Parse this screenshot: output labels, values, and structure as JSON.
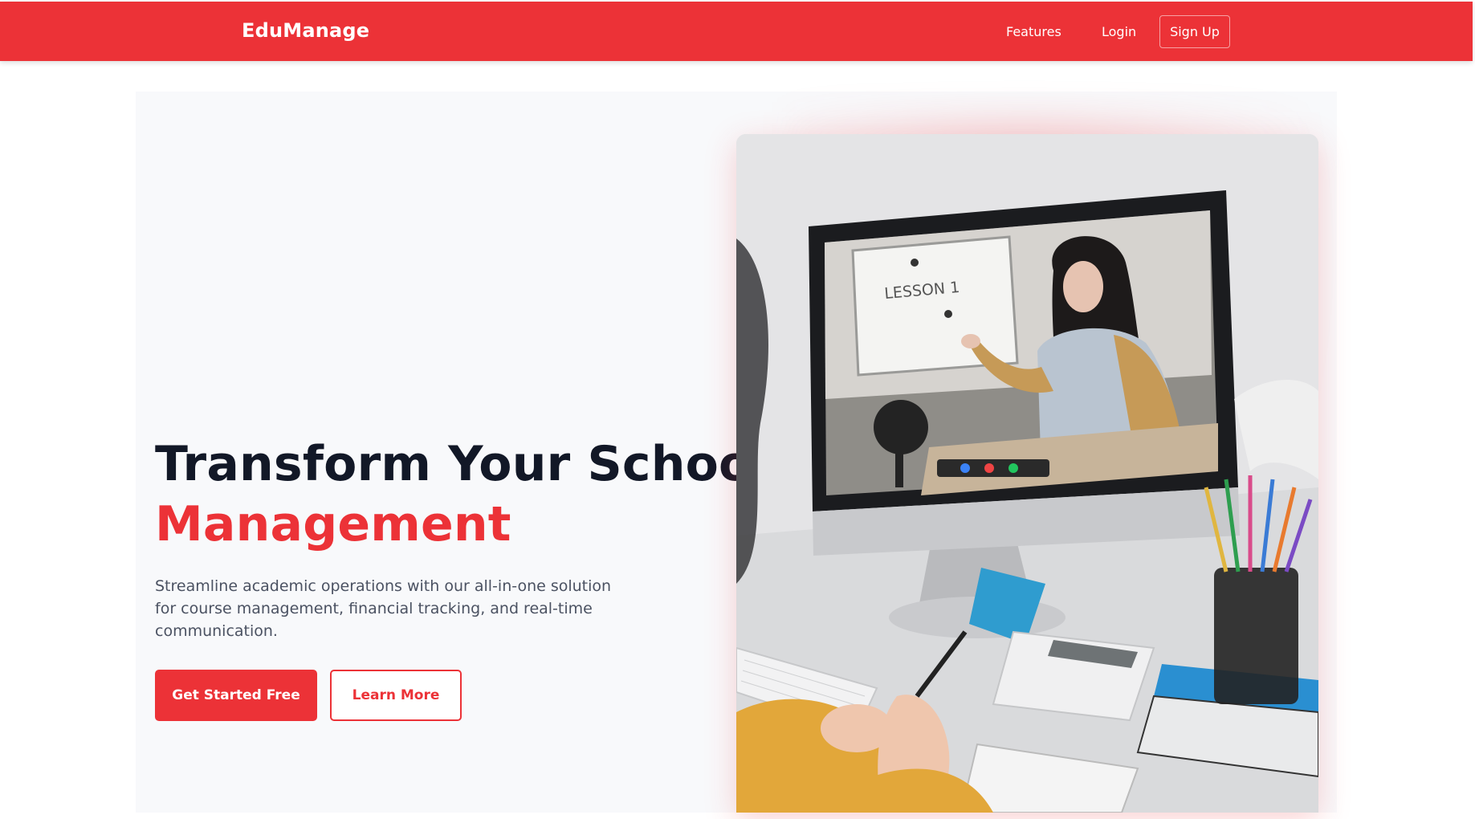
{
  "nav": {
    "brand": "EduManage",
    "links": [
      {
        "label": "Features"
      },
      {
        "label": "Login"
      }
    ],
    "signup_label": "Sign Up",
    "bg_color": "#ec3237"
  },
  "hero": {
    "title_line1": "Transform Your School",
    "title_line2": "Management",
    "subtitle": "Streamline academic operations with our all-in-one solution for course management, financial tracking, and real-time communication.",
    "primary_cta": "Get Started Free",
    "secondary_cta": "Learn More",
    "image": {
      "board_text": "LESSON 1"
    }
  },
  "colors": {
    "accent": "#ec3237",
    "heading": "#121827",
    "body_text": "#4b5262",
    "hero_bg": "#f8f9fb"
  }
}
